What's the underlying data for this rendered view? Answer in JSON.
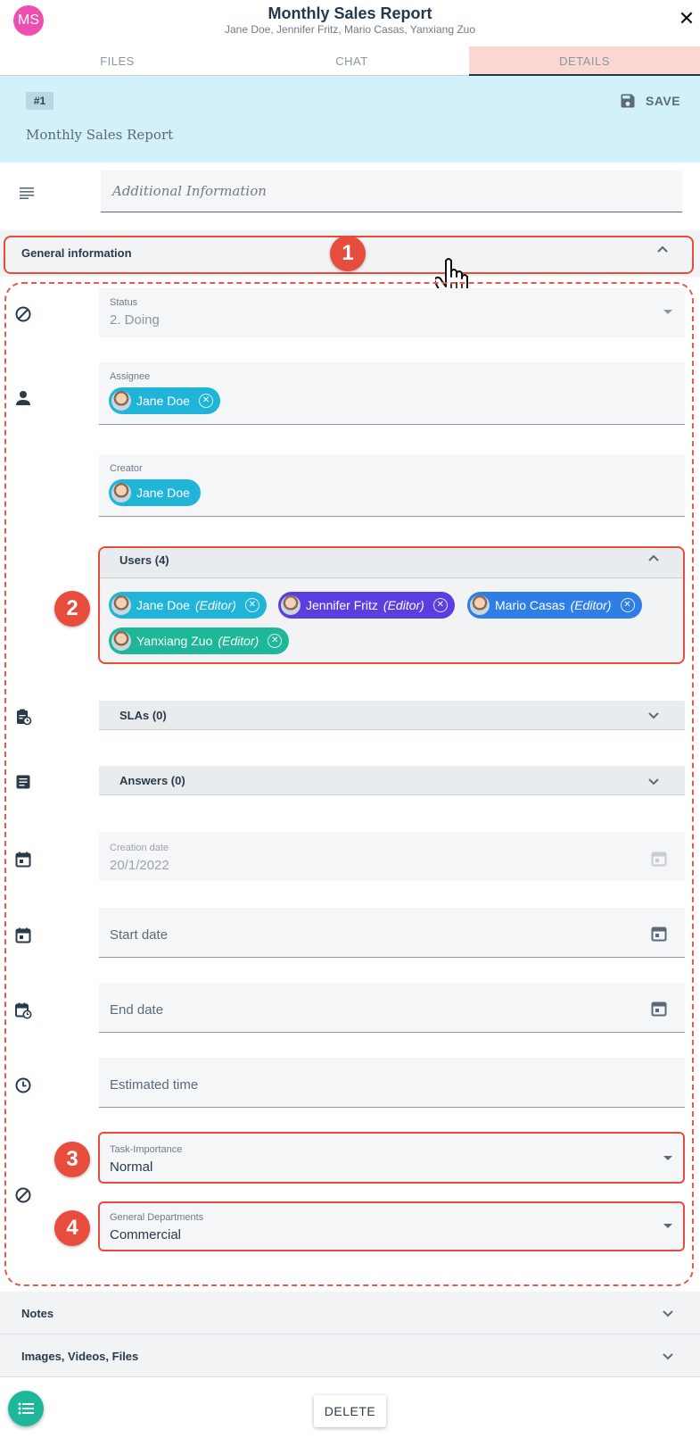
{
  "header": {
    "avatar_initials": "MS",
    "title": "Monthly Sales Report",
    "subtitle": "Jane Doe, Jennifer Fritz, Mario Casas, Yanxiang Zuo",
    "close": "✕"
  },
  "tabs": [
    "FILES",
    "CHAT",
    "DETAILS"
  ],
  "active_tab": "DETAILS",
  "banner": {
    "badge": "#1",
    "save_label": "SAVE",
    "title": "Monthly Sales Report"
  },
  "additional_info": {
    "placeholder": "Additional Information"
  },
  "general": {
    "label": "General information",
    "status": {
      "label": "Status",
      "value": "2. Doing"
    },
    "assignee": {
      "label": "Assignee",
      "chip": "Jane Doe"
    },
    "creator": {
      "label": "Creator",
      "chip": "Jane Doe"
    },
    "users": {
      "label": "Users (4)",
      "chips": [
        {
          "name": "Jane Doe",
          "role": "(Editor)"
        },
        {
          "name": "Jennifer Fritz",
          "role": "(Editor)"
        },
        {
          "name": "Mario Casas",
          "role": "(Editor)"
        },
        {
          "name": "Yanxiang Zuo",
          "role": "(Editor)"
        }
      ]
    },
    "slas": {
      "label": "SLAs (0)"
    },
    "answers": {
      "label": "Answers (0)"
    },
    "creation_date": {
      "label": "Creation date",
      "value": "20/1/2022"
    },
    "start_date": {
      "placeholder": "Start date"
    },
    "end_date": {
      "placeholder": "End date"
    },
    "estimated_time": {
      "placeholder": "Estimated time"
    },
    "task_importance": {
      "label": "Task-Importance",
      "value": "Normal"
    },
    "general_departments": {
      "label": "General Departments",
      "value": "Commercial"
    }
  },
  "sections": {
    "notes": "Notes",
    "media": "Images, Videos, Files"
  },
  "footer": {
    "delete_label": "DELETE"
  },
  "callouts": [
    "1",
    "2",
    "3",
    "4"
  ],
  "colors": {
    "accent_red": "#e74c3c",
    "chip_cyan": "#21b4d9",
    "chip_purple": "#5a3ee0",
    "chip_blue": "#2e7ee6",
    "chip_green": "#1fb79a",
    "banner": "#d3f1fa"
  },
  "icons": [
    "close-icon",
    "save-icon",
    "lines-icon",
    "chevron-up-icon",
    "chevron-down-icon",
    "block-icon",
    "person-icon",
    "clipboard-clock-icon",
    "document-icon",
    "calendar-icon",
    "calendar-clock-icon",
    "clock-icon",
    "list-icon",
    "hand-pointer-icon"
  ]
}
